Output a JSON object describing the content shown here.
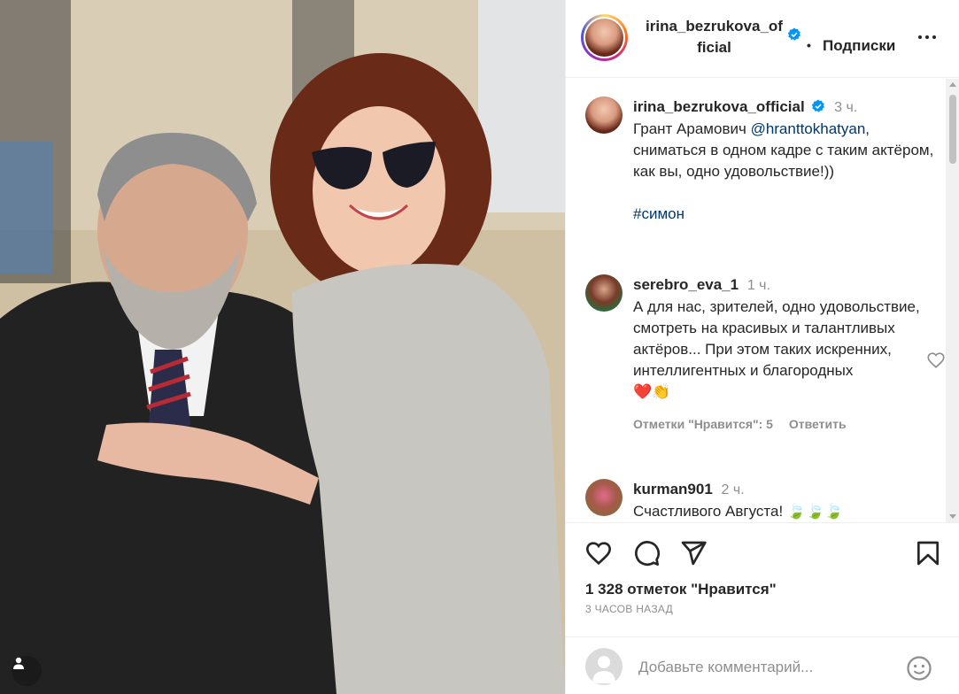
{
  "post": {
    "username": "irina_bezrukova_official",
    "username_wrapped": [
      "irina_bezrukova_of",
      "ficial"
    ],
    "follow_label": "Подписки",
    "dot": "•"
  },
  "caption": {
    "username": "irina_bezrukova_official",
    "time": "3 ч.",
    "text_before_mention": "Грант Арамович ",
    "mention": "@hranttokhatyan",
    "text_after_mention": ", сниматься в одном кадре с таким актёром, как вы, одно удовольствие!))",
    "hashtag": "#симон"
  },
  "comments": [
    {
      "username": "serebro_eva_1",
      "time": "1 ч.",
      "text": "А для нас, зрителей, одно удовольствие, смотреть на красивых и талантливых актёров... При этом таких искренних, интеллигентных и благородных",
      "emoji": "❤️👏",
      "likes_label": "Отметки \"Нравится\": 5",
      "reply_label": "Ответить"
    },
    {
      "username": "kurman901",
      "time": "2 ч.",
      "text": "Счастливого Августа!",
      "emoji": "🍃🍃🍃"
    }
  ],
  "likes": "1 328 отметок \"Нравится\"",
  "posted_ago": "3 ЧАСОВ НАЗАД",
  "comment_input": {
    "placeholder": "Добавьте комментарий..."
  },
  "icons": {
    "verified": "verified-badge-icon",
    "more": "more-options-icon",
    "like": "heart-icon",
    "comment": "comment-icon",
    "share": "share-icon",
    "save": "bookmark-icon",
    "emoji": "emoji-icon",
    "user_tags": "user-tag-icon"
  },
  "colors": {
    "verified_blue": "#0095f6",
    "link": "#00376b",
    "muted": "#8e8e8e",
    "text": "#262626"
  }
}
